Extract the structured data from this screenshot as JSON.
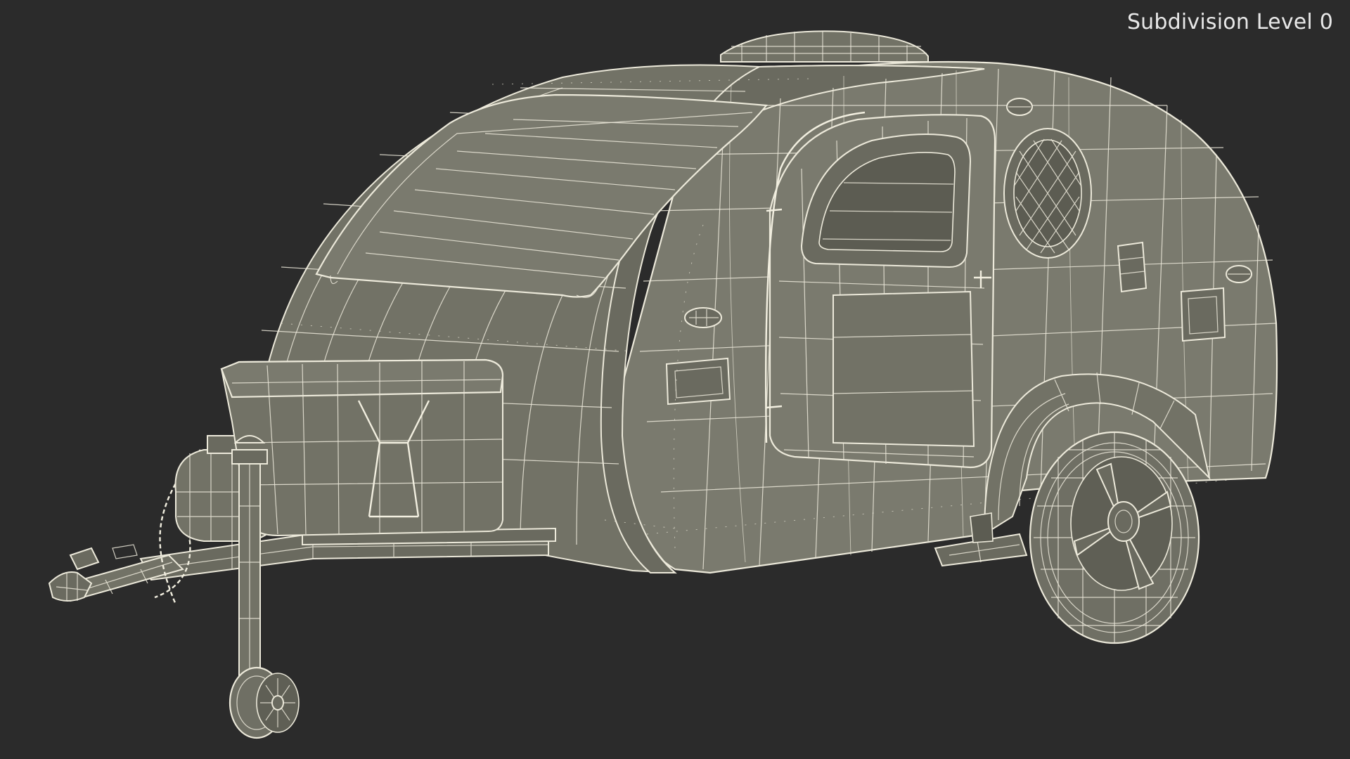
{
  "viewport": {
    "label": "Subdivision Level 0",
    "background": "#2b2b2b",
    "wire_color": "#ece9da",
    "surface_color": "#7a7a6e"
  }
}
